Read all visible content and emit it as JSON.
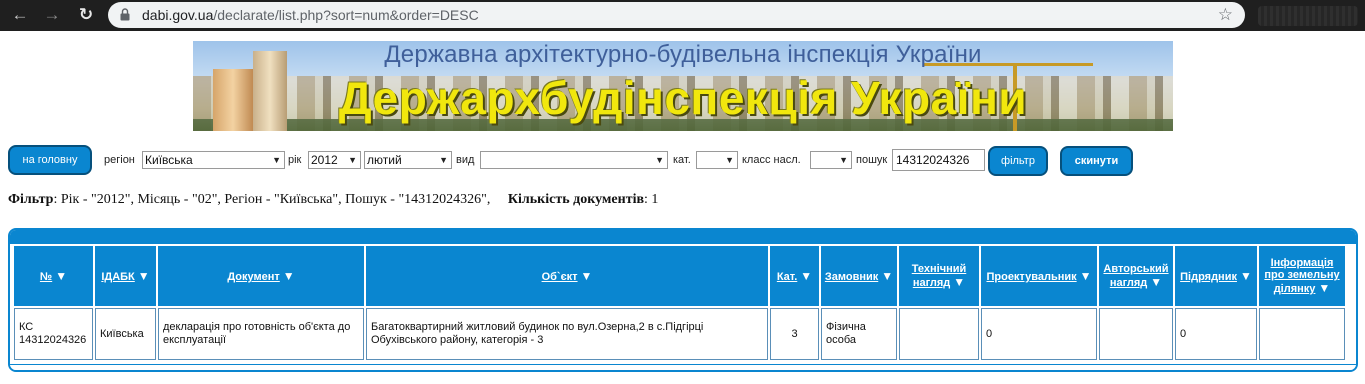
{
  "browser": {
    "url_host": "dabi.gov.ua",
    "url_path": "/declarate/list.php?sort=num&order=DESC"
  },
  "banner": {
    "subtitle": "Державна архітектурно-будівельна інспекція України",
    "title": "Держархбудінспекція України"
  },
  "filter_bar": {
    "home_button": "на головну",
    "region_label": "регіон",
    "region_value": "Київська",
    "year_label": "рік",
    "year_value": "2012",
    "month_value": "лютий",
    "type_label": "вид",
    "type_value": "",
    "category_label": "кат.",
    "category_value": "",
    "class_label": "класс насл.",
    "class_value": "",
    "search_label": "пошук",
    "search_value": "14312024326",
    "filter_button": "фільтр",
    "reset_button": "скинути"
  },
  "summary": {
    "filter_label": "Фільтр",
    "filter_text": ": Рік - \"2012\", Місяць - \"02\", Регіон - \"Київська\", Пошук - \"14312024326\",",
    "count_label": "Кількість документів",
    "count_text": ": 1"
  },
  "table": {
    "headers": {
      "num": "№",
      "idabk": "ІДАБК",
      "document": "Документ",
      "object": "Об`єкт",
      "category": "Кат.",
      "customer": "Замовник",
      "tech_supervision": "Технічний нагляд",
      "designer": "Проектувальник",
      "author_supervision": "Авторський нагляд",
      "contractor": "Підрядник",
      "land_info": "Інформація про земельну ділянку"
    },
    "rows": [
      {
        "num": "КС 14312024326",
        "idabk": "Київська",
        "document": "декларація про готовність об'єкта до експлуатації",
        "object": "Багатоквартирний житловий будинок по вул.Озерна,2 в с.Підгірці Обухівського району, категорія - 3",
        "category": "3",
        "customer": "Фізична особа",
        "tech_supervision": "",
        "designer": "0",
        "author_supervision": "",
        "contractor": "0",
        "land_info": ""
      }
    ]
  },
  "colors": {
    "accent": "#0a86d0",
    "banner_title": "#f1e70d"
  }
}
